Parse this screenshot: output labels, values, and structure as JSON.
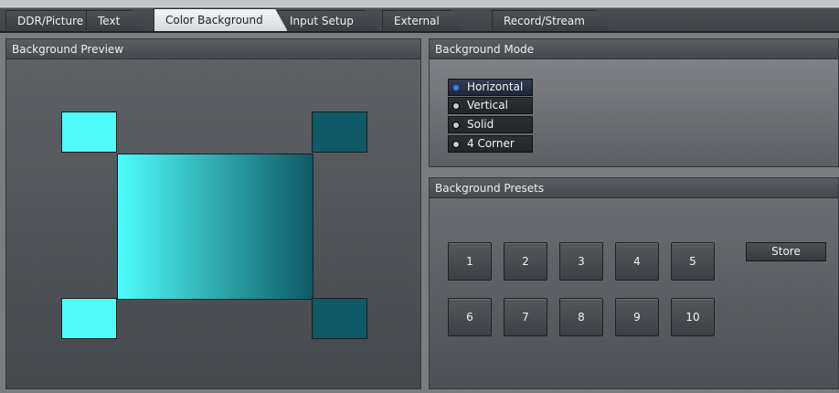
{
  "tabs": [
    {
      "label": "DDR/Picture",
      "active": false
    },
    {
      "label": "Text",
      "active": false
    },
    {
      "label": "Color Background",
      "active": true
    },
    {
      "label": "Input Setup",
      "active": false
    },
    {
      "label": "External",
      "active": false
    },
    {
      "label": "Record/Stream",
      "active": false
    }
  ],
  "preview": {
    "title": "Background Preview",
    "colors": {
      "top_left": "#4ffcfc",
      "top_right": "#0e5a66",
      "bottom_left": "#4ffcfc",
      "bottom_right": "#0e5a66"
    },
    "gradient": {
      "from": "#4ffcfc",
      "to": "#0e5a66",
      "direction": "horizontal"
    }
  },
  "mode": {
    "title": "Background Mode",
    "options": [
      {
        "label": "Horizontal",
        "selected": true
      },
      {
        "label": "Vertical",
        "selected": false
      },
      {
        "label": "Solid",
        "selected": false
      },
      {
        "label": "4 Corner",
        "selected": false
      }
    ]
  },
  "presets": {
    "title": "Background Presets",
    "buttons": [
      "1",
      "2",
      "3",
      "4",
      "5",
      "6",
      "7",
      "8",
      "9",
      "10"
    ],
    "store_label": "Store"
  }
}
